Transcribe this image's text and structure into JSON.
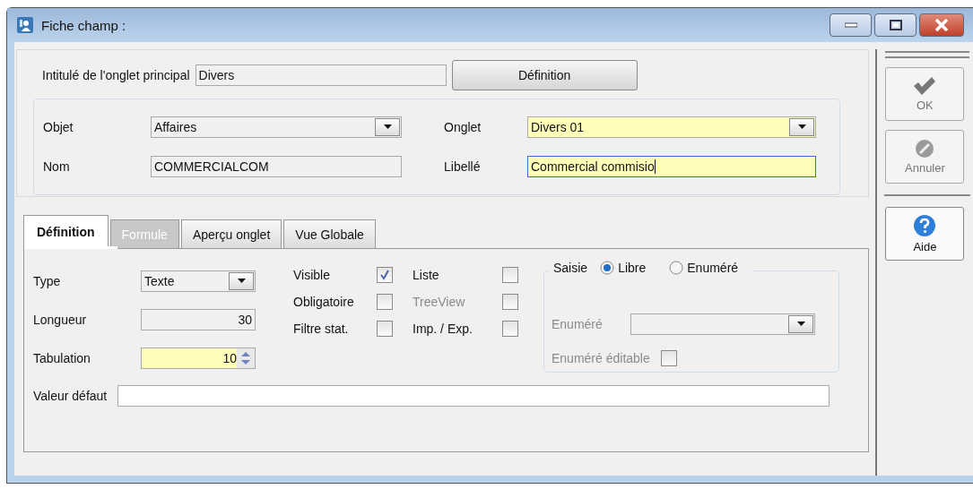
{
  "window": {
    "title": "Fiche champ :"
  },
  "header": {
    "label": "Intitulé de l'onglet principal",
    "value": "Divers",
    "button": "Définition"
  },
  "object_fields": [
    {
      "label": "Objet",
      "value": "Affaires",
      "kind": "dropdown",
      "required": false,
      "focused": false
    },
    {
      "label": "Onglet",
      "value": "Divers 01",
      "kind": "dropdown",
      "required": true,
      "focused": false
    },
    {
      "label": "Nom",
      "value": "COMMERCIALCOM",
      "kind": "readonly",
      "required": false,
      "focused": false
    },
    {
      "label": "Libellé",
      "value": "Commercial commisio",
      "kind": "text",
      "required": true,
      "focused": true
    }
  ],
  "tabs": [
    {
      "label": "Définition",
      "selected": true,
      "disabled": false
    },
    {
      "label": "Formule",
      "selected": false,
      "disabled": true
    },
    {
      "label": "Aperçu onglet",
      "selected": false,
      "disabled": false
    },
    {
      "label": "Vue Globale",
      "selected": false,
      "disabled": false
    }
  ],
  "definition": {
    "fields": [
      {
        "label": "Type",
        "value": "Texte",
        "kind": "dropdown",
        "required": false
      },
      {
        "label": "Longueur",
        "value": "30",
        "kind": "readonly",
        "required": false
      },
      {
        "label": "Tabulation",
        "value": "10",
        "kind": "spinner",
        "required": true
      }
    ],
    "checkboxes": [
      {
        "label": "Visible",
        "checked": true,
        "disabled": false
      },
      {
        "label": "Liste",
        "checked": false,
        "disabled": false
      },
      {
        "label": "Obligatoire",
        "checked": false,
        "disabled": false
      },
      {
        "label": "TreeView",
        "checked": false,
        "disabled": true
      },
      {
        "label": "Filtre stat.",
        "checked": false,
        "disabled": false
      },
      {
        "label": "Imp. / Exp.",
        "checked": false,
        "disabled": false
      }
    ],
    "saisie": {
      "legend": "Saisie",
      "options": [
        {
          "label": "Libre",
          "selected": true
        },
        {
          "label": "Enuméré",
          "selected": false
        }
      ],
      "enum_label": "Enuméré",
      "enum_disabled": true,
      "editable_label": "Enuméré éditable",
      "editable_checked": false,
      "editable_disabled": true
    },
    "default_value": {
      "label": "Valeur défaut"
    }
  },
  "side_buttons": [
    {
      "label": "OK",
      "kind": "ok",
      "disabled": true
    },
    {
      "label": "Annuler",
      "kind": "cancel",
      "disabled": true
    },
    {
      "label": "Aide",
      "kind": "help",
      "disabled": false
    }
  ]
}
